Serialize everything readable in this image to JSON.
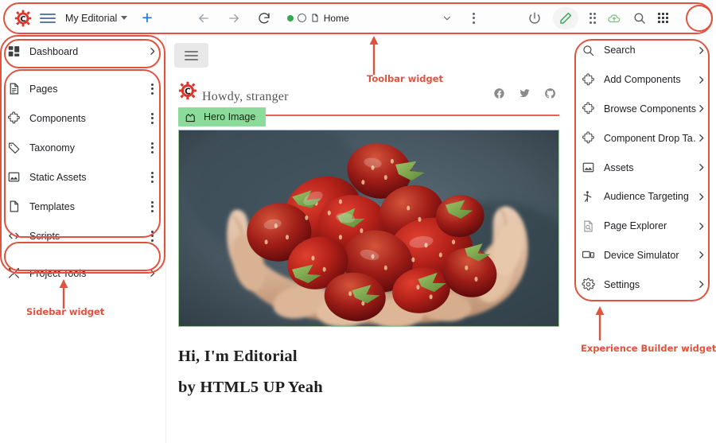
{
  "toolbar": {
    "project_name": "My Editorial",
    "new_tab_label": "+",
    "tab": {
      "title": "Home",
      "status_dot_color": "#34a853"
    },
    "nav": {
      "back": "back-arrow",
      "forward": "forward-arrow",
      "reload": "reload"
    },
    "actions": [
      {
        "name": "power-icon",
        "label": "Power"
      },
      {
        "name": "edit-pencil-icon",
        "label": "Edit",
        "color": "#34a853"
      },
      {
        "name": "apps-dots-icon",
        "label": "Apps"
      },
      {
        "name": "cloud-upload-icon",
        "label": "Publish",
        "color": "#7fc08a"
      },
      {
        "name": "search-icon",
        "label": "Search"
      },
      {
        "name": "app-grid-icon",
        "label": "App Grid"
      }
    ]
  },
  "sidebar": {
    "top": {
      "label": "Dashboard",
      "icon": "dashboard-icon"
    },
    "items": [
      {
        "label": "Pages",
        "icon": "page-icon"
      },
      {
        "label": "Components",
        "icon": "puzzle-icon"
      },
      {
        "label": "Taxonomy",
        "icon": "tag-icon"
      },
      {
        "label": "Static Assets",
        "icon": "image-icon"
      },
      {
        "label": "Templates",
        "icon": "file-icon"
      },
      {
        "label": "Scripts",
        "icon": "code-icon"
      }
    ],
    "bottom": {
      "label": "Project Tools",
      "icon": "tools-icon"
    }
  },
  "main": {
    "menu_button": "hamburger-menu",
    "site_title": "Howdy, stranger",
    "social": [
      {
        "name": "facebook-icon",
        "label": "Facebook"
      },
      {
        "name": "twitter-icon",
        "label": "Twitter"
      },
      {
        "name": "github-icon",
        "label": "GitHub"
      }
    ],
    "hero_badge": "Hero Image",
    "post_title": "Hi, I'm Editorial",
    "post_subtitle": "by HTML5 UP Yeah"
  },
  "right_panel": {
    "items": [
      {
        "label": "Search",
        "icon": "search-icon"
      },
      {
        "label": "Add Components",
        "icon": "puzzle-icon"
      },
      {
        "label": "Browse Components",
        "icon": "puzzle-icon"
      },
      {
        "label": "Component Drop Ta…",
        "icon": "puzzle-icon"
      },
      {
        "label": "Assets",
        "icon": "image-icon"
      },
      {
        "label": "Audience Targeting",
        "icon": "person-icon"
      },
      {
        "label": "Page Explorer",
        "icon": "page-search-icon"
      },
      {
        "label": "Device Simulator",
        "icon": "devices-icon"
      },
      {
        "label": "Settings",
        "icon": "gear-icon"
      }
    ]
  },
  "annotations": {
    "accent_color": "#e0533f",
    "labels": [
      {
        "text": "Toolbar widget"
      },
      {
        "text": "Sidebar widget"
      },
      {
        "text": "Experience Builder widget"
      }
    ]
  }
}
